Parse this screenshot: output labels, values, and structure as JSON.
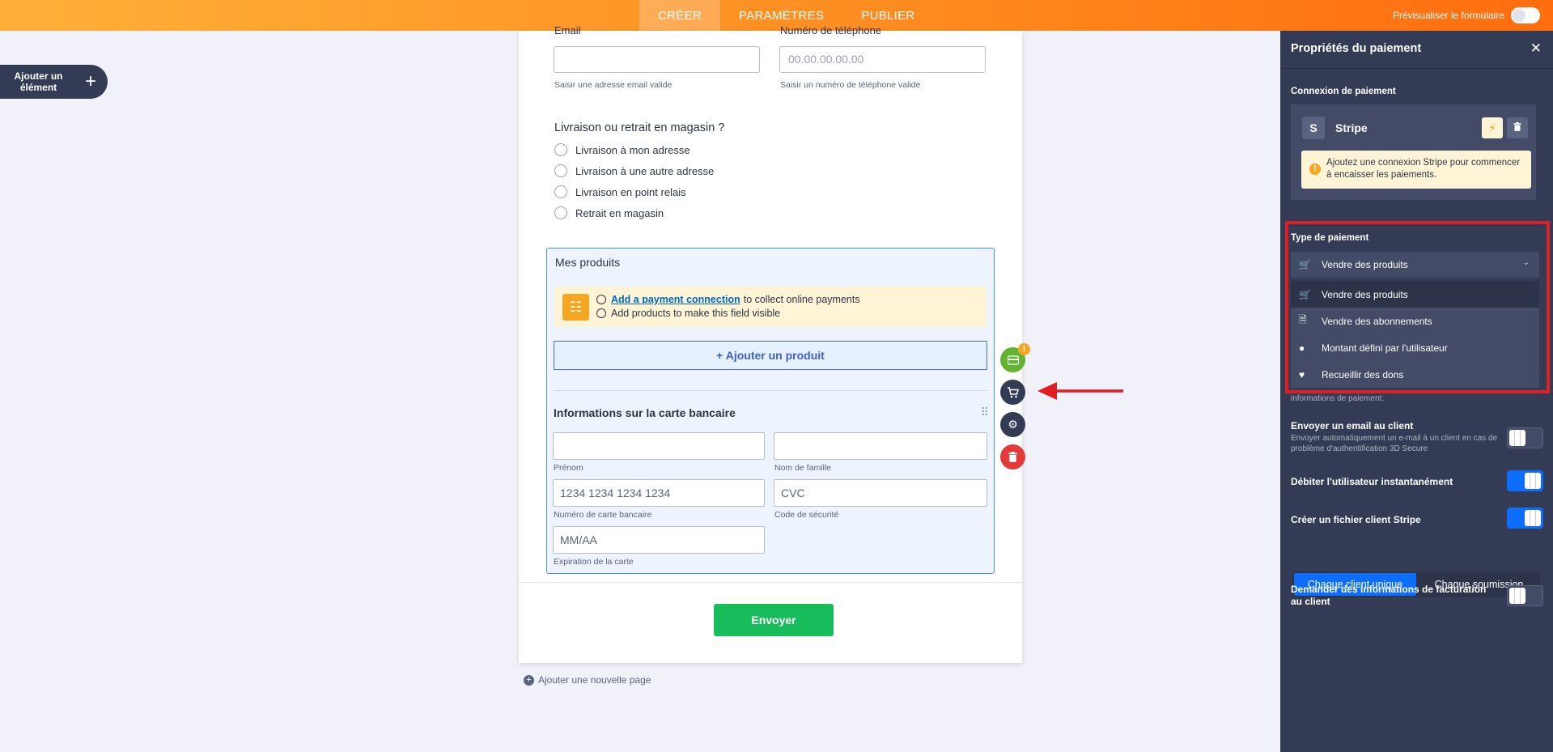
{
  "topbar": {
    "tabs": [
      "CRÉER",
      "PARAMÈTRES",
      "PUBLIER"
    ],
    "preview_label": "Prévisualiser le formulaire"
  },
  "add_element": {
    "label": "Ajouter un élément"
  },
  "form": {
    "email_label": "Email",
    "email_sub": "Saisir une adresse email valide",
    "phone_label": "Numéro de téléphone",
    "phone_placeholder": "00.00.00.00.00",
    "phone_sub": "Saisir un numéro de téléphone valide",
    "delivery_question": "Livraison ou retrait en magasin ?",
    "delivery_options": [
      "Livraison à mon adresse",
      "Livraison à une autre adresse",
      "Livraison en point relais",
      "Retrait en magasin"
    ],
    "products": {
      "title": "Mes produits",
      "warn_link": "Add a payment connection",
      "warn_line1_rest": "to collect online payments",
      "warn_line2": "Add products to make this field visible",
      "add_product": "+ Ajouter un produit",
      "card_title": "Informations sur la carte bancaire",
      "first_name_sub": "Prénom",
      "last_name_sub": "Nom de famille",
      "card_number_placeholder": "1234 1234 1234 1234",
      "card_number_sub": "Numéro de carte bancaire",
      "cvc_placeholder": "CVC",
      "cvc_sub": "Code de sécurité",
      "expiry_placeholder": "MM/AA",
      "expiry_sub": "Expiration de la carte"
    },
    "submit_label": "Envoyer",
    "add_page": "Ajouter une nouvelle page"
  },
  "field_actions": {
    "badge": "!"
  },
  "panel": {
    "title": "Propriétés du paiement",
    "connection_label": "Connexion de paiement",
    "stripe_letter": "S",
    "stripe_name": "Stripe",
    "stripe_alert": "Ajoutez une connexion Stripe pour commencer à encaisser les paiements.",
    "payment_type_label": "Type de paiement",
    "payment_type_selected": "Vendre des produits",
    "payment_type_options": [
      "Vendre des produits",
      "Vendre des abonnements",
      "Montant défini par l'utilisateur",
      "Recueillir des dons"
    ],
    "behind_text": "informations de paiement.",
    "email_customer_title": "Envoyer un email au client",
    "email_customer_desc": "Envoyer automatiquement un e-mail à un client en cas de problème d'authentification 3D Secure",
    "charge_now_title": "Débiter l'utilisateur instantanément",
    "create_customer_title": "Créer un fichier client Stripe",
    "seg_option_1": "Chaque client unique",
    "seg_option_2": "Chaque soumission",
    "billing_title": "Demander des informations de facturation au client"
  },
  "colors": {
    "accent": "#ff8a1f",
    "panel_bg": "#343c55",
    "highlight": "#e01e25",
    "submit": "#18bd5b"
  }
}
